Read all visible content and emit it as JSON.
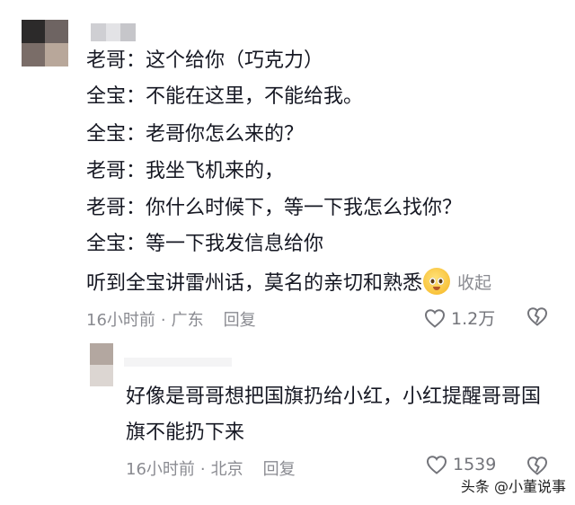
{
  "comment": {
    "lines": [
      "老哥：这个给你（巧克力）",
      "全宝：不能在这里，不能给我。",
      "全宝：老哥你怎么来的？",
      "老哥：我坐飞机来的，",
      "老哥：你什么时候下，等一下我怎么找你？",
      "全宝：等一下我发信息给你",
      "听到全宝讲雷州话，莫名的亲切和熟悉"
    ],
    "emoji": "crying-face-emoji-icon",
    "collapse_label": "收起",
    "time": "16小时前",
    "dot": "·",
    "location": "广东",
    "reply_label": "回复",
    "likes": "1.2万"
  },
  "reply": {
    "text": "好像是哥哥想把国旗扔给小红，小红提醒哥哥国旗不能扔下来",
    "time": "16小时前",
    "dot": "·",
    "location": "北京",
    "reply_label": "回复",
    "likes": "1539"
  },
  "watermark": "头条 @小董说事",
  "colors": {
    "text": "#161823",
    "meta": "#8a8b91",
    "icon": "#73747a"
  }
}
